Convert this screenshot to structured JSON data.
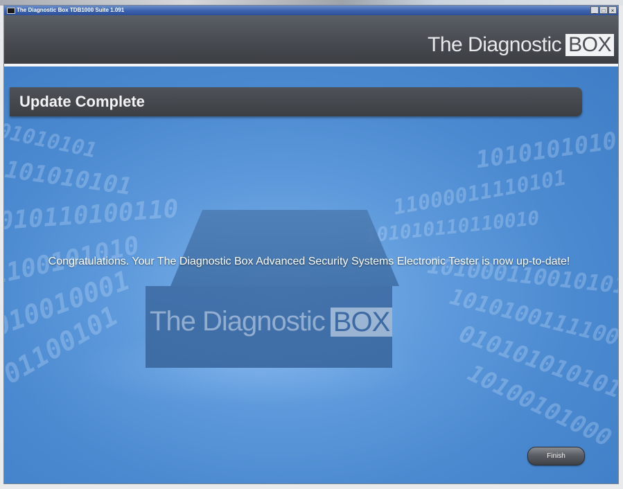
{
  "window": {
    "title": "The Diagnostic Box TDB1000 Suite 1.091",
    "controls": {
      "minimize": "_",
      "maximize": "□",
      "close": "×"
    }
  },
  "header": {
    "brand_text": "The Diagnostic",
    "brand_box": "BOX"
  },
  "page": {
    "title": "Update Complete",
    "message": "Congratulations. Your The Diagnostic Box Advanced Security Systems Electronic Tester is now up-to-date!",
    "finish_label": "Finish"
  },
  "illustration": {
    "logo_text": "The Diagnostic",
    "logo_box": "BOX"
  },
  "colors": {
    "header_bg": "#46494f",
    "content_bg": "#5d99db",
    "title_band": "#3c3f44",
    "titlebar": "#3e64b0"
  },
  "icons": [
    "app-icon",
    "minimize-icon",
    "maximize-icon",
    "close-icon"
  ]
}
